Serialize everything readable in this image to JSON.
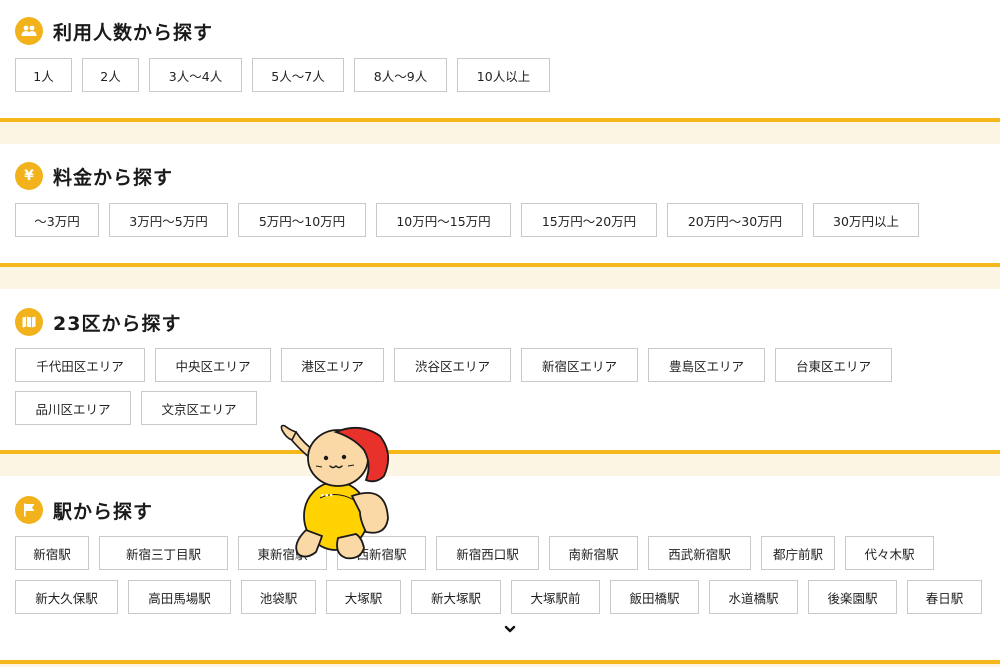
{
  "sections": {
    "people": {
      "title": "利用人数から探す",
      "icon": "people-icon",
      "buttons": [
        "1人",
        "2人",
        "3人〜4人",
        "5人〜7人",
        "8人〜9人",
        "10人以上"
      ]
    },
    "price": {
      "title": "料金から探す",
      "icon": "yen-icon",
      "icon_text": "¥",
      "buttons": [
        "〜3万円",
        "3万円〜5万円",
        "5万円〜10万円",
        "10万円〜15万円",
        "15万円〜20万円",
        "20万円〜30万円",
        "30万円以上"
      ]
    },
    "ward": {
      "title": "23区から探す",
      "icon": "map-icon",
      "buttons_row1": [
        "千代田区エリア",
        "中央区エリア",
        "港区エリア",
        "渋谷区エリア",
        "新宿区エリア",
        "豊島区エリア",
        "台東区エリア"
      ],
      "buttons_row2": [
        "品川区エリア",
        "文京区エリア"
      ]
    },
    "station": {
      "title": "駅から探す",
      "icon": "flag-icon",
      "buttons_row1": [
        "新宿駅",
        "新宿三丁目駅",
        "東新宿駅",
        "西新宿駅",
        "新宿西口駅",
        "南新宿駅",
        "西武新宿駅",
        "都庁前駅",
        "代々木駅"
      ],
      "buttons_row2": [
        "新大久保駅",
        "高田馬場駅",
        "池袋駅",
        "大塚駅",
        "新大塚駅",
        "大塚駅前",
        "飯田橋駅",
        "水道橋駅",
        "後楽園駅",
        "春日駅"
      ],
      "more_icon": "chevron-down-icon"
    }
  },
  "mascot": {
    "icon": "mascot-character"
  },
  "colors": {
    "accent": "#f2b21b",
    "divider": "#f5b81c",
    "band": "#fdf5e3",
    "border": "#c9c9c9"
  }
}
